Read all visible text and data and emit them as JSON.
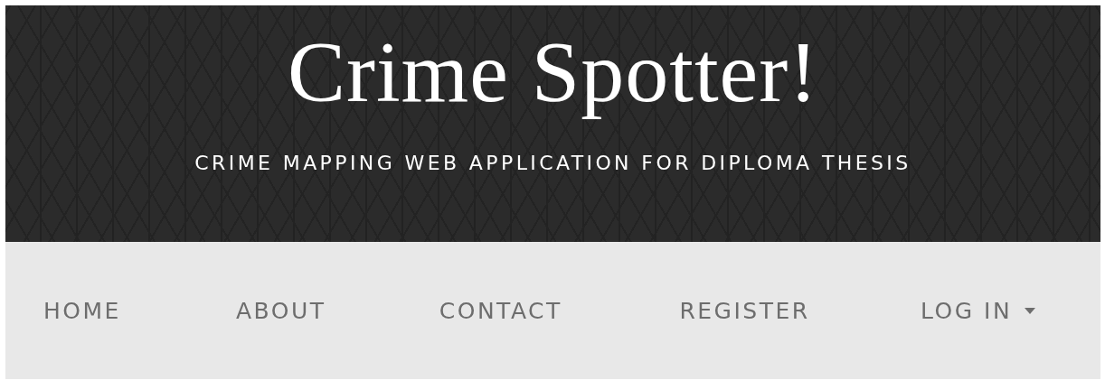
{
  "header": {
    "title": "Crime Spotter!",
    "subtitle": "CRIME MAPPING WEB APPLICATION FOR DIPLOMA THESIS"
  },
  "nav": {
    "items": [
      {
        "label": "HOME",
        "kind": "link"
      },
      {
        "label": "ABOUT",
        "kind": "link"
      },
      {
        "label": "CONTACT",
        "kind": "link"
      },
      {
        "label": "REGISTER",
        "kind": "link"
      },
      {
        "label": "LOG IN",
        "kind": "dropdown"
      }
    ]
  }
}
